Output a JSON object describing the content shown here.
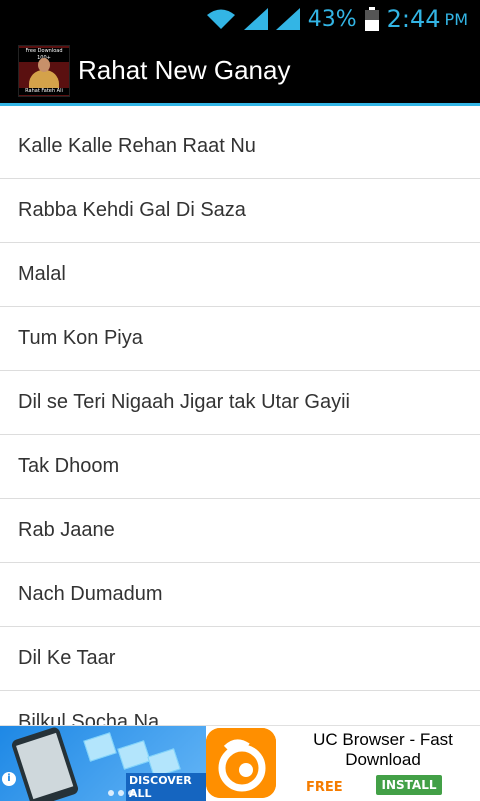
{
  "status_bar": {
    "battery_percent": "43%",
    "time": "2:44",
    "ampm": "PM",
    "accent_color": "#33b5e5"
  },
  "action_bar": {
    "title": "Rahat New Ganay",
    "icon": {
      "top_text": "Free Download 100+",
      "bottom_text": "Rahat Fateh Ali"
    }
  },
  "songs": [
    "Kalle Kalle Rehan Raat Nu",
    "Rabba Kehdi Gal Di Saza",
    "Malal",
    "Tum Kon Piya",
    "Dil se Teri Nigaah Jigar tak Utar Gayii",
    "Tak Dhoom",
    "Rab Jaane",
    "Nach Dumadum",
    "Dil Ke Taar",
    "Bilkul Socha Na"
  ],
  "ad": {
    "discover_label": "DISCOVER ALL",
    "title": "UC Browser - Fast Download",
    "free_label": "FREE",
    "install_label": "INSTALL",
    "info_icon": "i"
  }
}
